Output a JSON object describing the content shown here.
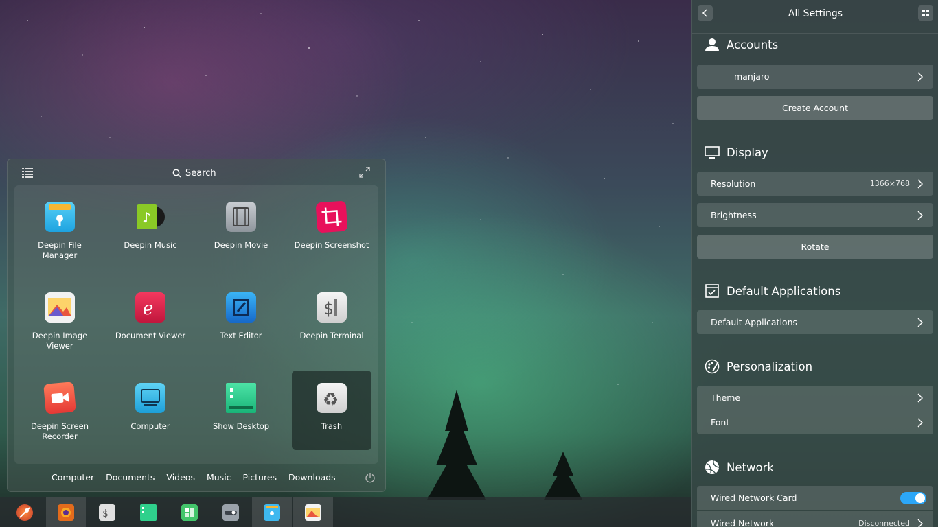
{
  "launcher": {
    "search_placeholder": "Search",
    "apps": [
      {
        "label": "Deepin File Manager",
        "icon": "file-manager-icon"
      },
      {
        "label": "Deepin Music",
        "icon": "music-icon"
      },
      {
        "label": "Deepin Movie",
        "icon": "movie-icon"
      },
      {
        "label": "Deepin Screenshot",
        "icon": "screenshot-icon"
      },
      {
        "label": "Deepin Image Viewer",
        "icon": "image-viewer-icon"
      },
      {
        "label": "Document Viewer",
        "icon": "document-viewer-icon"
      },
      {
        "label": "Text Editor",
        "icon": "text-editor-icon"
      },
      {
        "label": "Deepin Terminal",
        "icon": "terminal-icon"
      },
      {
        "label": "Deepin Screen Recorder",
        "icon": "screen-recorder-icon"
      },
      {
        "label": "Computer",
        "icon": "computer-icon"
      },
      {
        "label": "Show Desktop",
        "icon": "show-desktop-icon"
      },
      {
        "label": "Trash",
        "icon": "trash-icon"
      }
    ],
    "selected_app": "Trash",
    "folders": [
      "Computer",
      "Documents",
      "Videos",
      "Music",
      "Pictures",
      "Downloads"
    ]
  },
  "taskbar": {
    "items": [
      "launcher-icon",
      "firefox-icon",
      "terminal-icon",
      "show-desktop-icon",
      "system-monitor-icon",
      "control-center-icon",
      "file-manager-icon",
      "image-viewer-icon"
    ],
    "active_items": [
      "firefox-icon",
      "file-manager-icon",
      "image-viewer-icon"
    ]
  },
  "settings": {
    "title": "All Settings",
    "accounts": {
      "title": "Accounts",
      "user": "manjaro",
      "create_label": "Create Account"
    },
    "display": {
      "title": "Display",
      "resolution_label": "Resolution",
      "resolution_value": "1366×768",
      "brightness_label": "Brightness",
      "rotate_label": "Rotate"
    },
    "default_apps": {
      "title": "Default Applications",
      "row_label": "Default Applications"
    },
    "personalization": {
      "title": "Personalization",
      "theme_label": "Theme",
      "font_label": "Font"
    },
    "network": {
      "title": "Network",
      "wired_card_label": "Wired Network Card",
      "wired_card_enabled": true,
      "wired_network_label": "Wired Network",
      "wired_network_status": "Disconnected"
    }
  }
}
